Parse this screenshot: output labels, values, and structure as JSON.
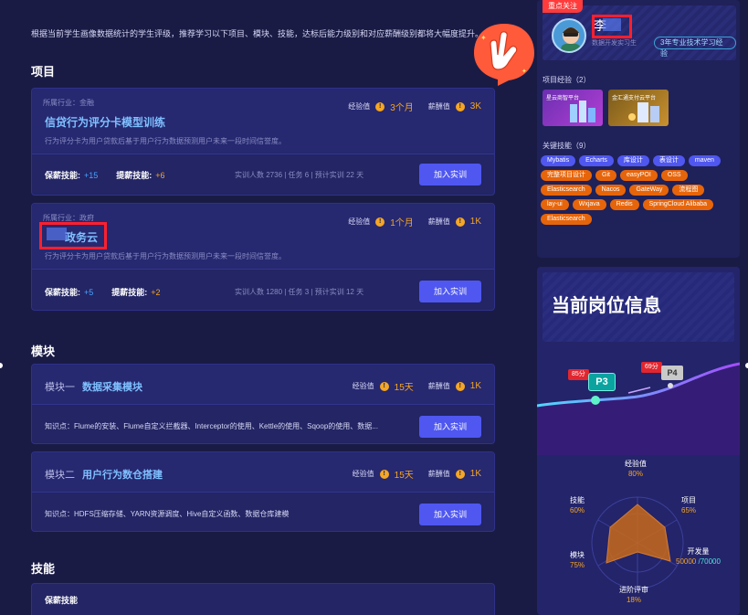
{
  "intro": "根据当前学生画像数据统计的学生评级，推荐学习以下项目、模块、技能，达标后能力级别和对应薪酬级别都将大幅度提升。",
  "sections": {
    "projects": "项目",
    "modules": "模块",
    "skills": "技能"
  },
  "labels": {
    "exp": "经验值",
    "salary": "薪酬值",
    "salary_skill": "保薪技能:",
    "raise_skill": "提薪技能:",
    "join": "加入实训",
    "knowledge_prefix": "知识点："
  },
  "projects": [
    {
      "industry": "所属行业：金融",
      "title": "信贷行为评分卡模型训练",
      "desc": "行为评分卡为用户贷款后基于用户行为数据预测用户未来一段时间信誉度。",
      "exp": "3个月",
      "salary": "3K",
      "salary_skill_n": "+15",
      "raise_skill_n": "+6",
      "stats": "实训人数 2736  |  任务 6  |  预计实训 22 天"
    },
    {
      "industry": "所属行业：政府",
      "title": "政务云",
      "desc": "行为评分卡为用户贷款后基于用户行为数据预测用户未来一段时间信誉度。",
      "exp": "1个月",
      "salary": "1K",
      "salary_skill_n": "+5",
      "raise_skill_n": "+2",
      "stats": "实训人数 1280  |  任务 3  |  预计实训 12 天"
    }
  ],
  "modules": [
    {
      "no": "模块一",
      "name": "数据采集模块",
      "exp": "15天",
      "salary": "1K",
      "knowledge": "Flume的安装、Flume自定义拦截器、Interceptor的使用、Kettle的使用、Sqoop的使用、数据..."
    },
    {
      "no": "模块二",
      "name": "用户行为数仓搭建",
      "exp": "15天",
      "salary": "1K",
      "knowledge": "HDFS压缩存储、YARN资源调度、Hive自定义函数、数据仓库建模"
    }
  ],
  "skills_section": {
    "first_row": "保薪技能"
  },
  "sidebar": {
    "focus_tag": "重点关注",
    "name_char": "李",
    "name_sub": "数据开发实习生",
    "exp_badge": "3年专业技术学习经验",
    "project_exp_label": "项目经验（2）",
    "project_thumbs": [
      "星云商智平台",
      "金汇通支付云平台"
    ],
    "key_skills_label": "关键技能（9）",
    "chips": [
      {
        "t": "Mybatis",
        "c": "blue"
      },
      {
        "t": "Echarts",
        "c": "blue"
      },
      {
        "t": "库设计",
        "c": "blue"
      },
      {
        "t": "表设计",
        "c": "blue"
      },
      {
        "t": "maven",
        "c": "blue"
      },
      {
        "t": "完整项目设计",
        "c": "orange"
      },
      {
        "t": "Git",
        "c": "orange"
      },
      {
        "t": "easyPOI",
        "c": "orange"
      },
      {
        "t": "OSS",
        "c": "orange"
      },
      {
        "t": "Elasticsearch",
        "c": "orange"
      },
      {
        "t": "Nacos",
        "c": "orange"
      },
      {
        "t": "GateWay",
        "c": "orange"
      },
      {
        "t": "流程图",
        "c": "orange"
      },
      {
        "t": "lay-ui",
        "c": "orange"
      },
      {
        "t": "Wxjava",
        "c": "orange"
      },
      {
        "t": "Redis",
        "c": "orange"
      },
      {
        "t": "SpringCloud Alibaba",
        "c": "orange"
      },
      {
        "t": "Elasticsearch",
        "c": "orange"
      }
    ],
    "position_title": "当前岗位信息",
    "levels": {
      "current": "P3",
      "current_score": "85分",
      "next": "P4",
      "next_score": "69分"
    },
    "radar": {
      "exp": {
        "label": "经验值",
        "pct": "80%"
      },
      "project": {
        "label": "项目",
        "pct": "65%"
      },
      "dev": {
        "label": "开发量",
        "current": "50000",
        "total": "/70000"
      },
      "review": {
        "label": "进阶评审",
        "pct": "18%"
      },
      "module": {
        "label": "模块",
        "pct": "75%"
      },
      "skill": {
        "label": "技能",
        "pct": "60%"
      }
    }
  }
}
